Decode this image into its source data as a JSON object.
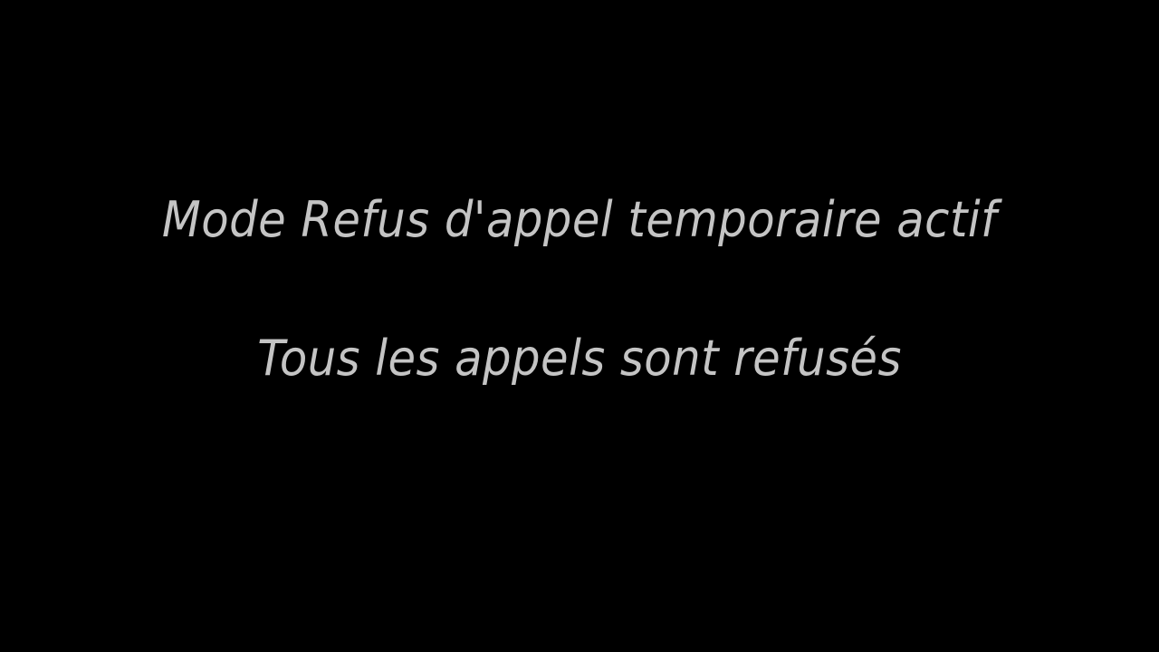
{
  "screen": {
    "message_title": "Mode Refus d'appel temporaire actif",
    "message_detail": "Tous les appels sont refusés",
    "colors": {
      "background": "#000000",
      "text": "#c4c4c4"
    }
  }
}
